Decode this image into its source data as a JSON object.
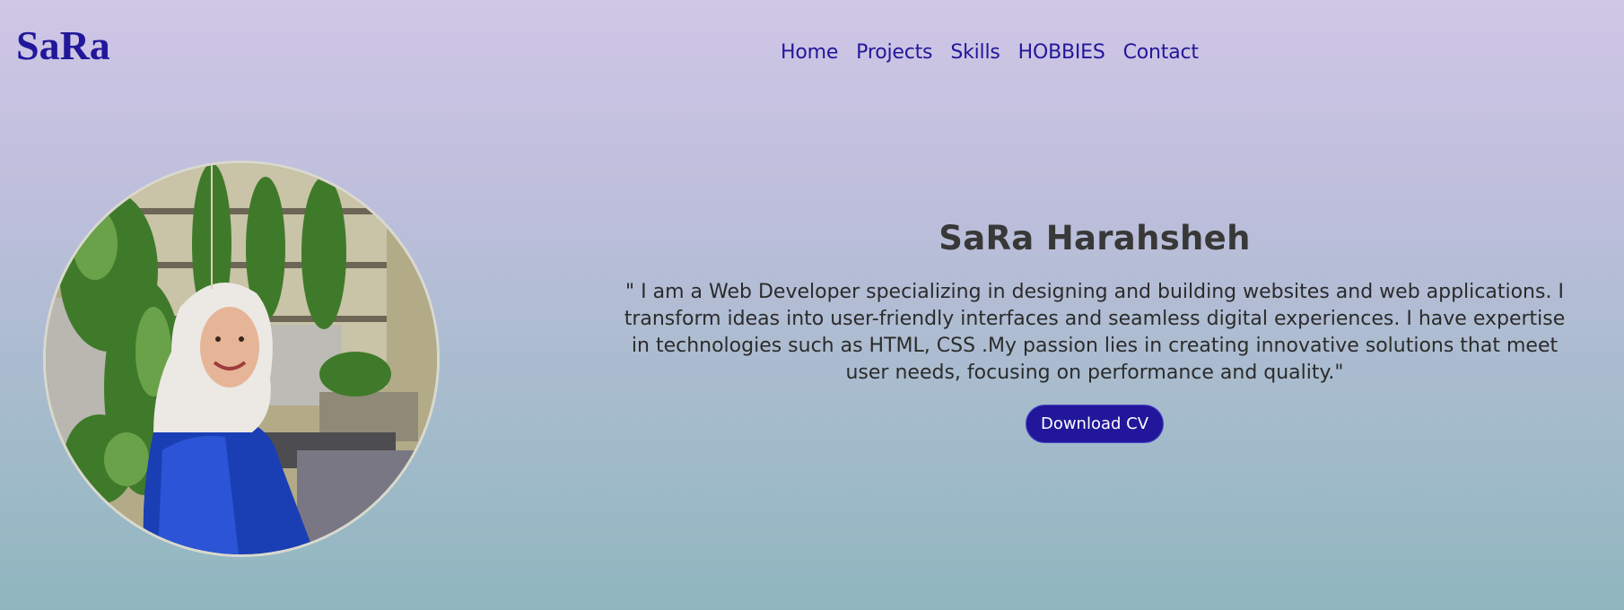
{
  "header": {
    "logo": "SaRa",
    "nav": [
      {
        "label": "Home"
      },
      {
        "label": "Projects"
      },
      {
        "label": "Skills"
      },
      {
        "label": "HOBBIES"
      },
      {
        "label": "Contact"
      }
    ]
  },
  "hero": {
    "name": "SaRa Harahsheh",
    "bio": "\" I am a Web Developer specializing in designing and building websites and web applications. I transform ideas into user-friendly interfaces and seamless digital experiences. I have expertise in technologies such as HTML, CSS .My passion lies in creating innovative solutions that meet user needs, focusing on performance and quality.\"",
    "button_label": "Download CV"
  },
  "colors": {
    "brand": "#22179a",
    "button_bg": "#22179a",
    "text": "#383838"
  }
}
